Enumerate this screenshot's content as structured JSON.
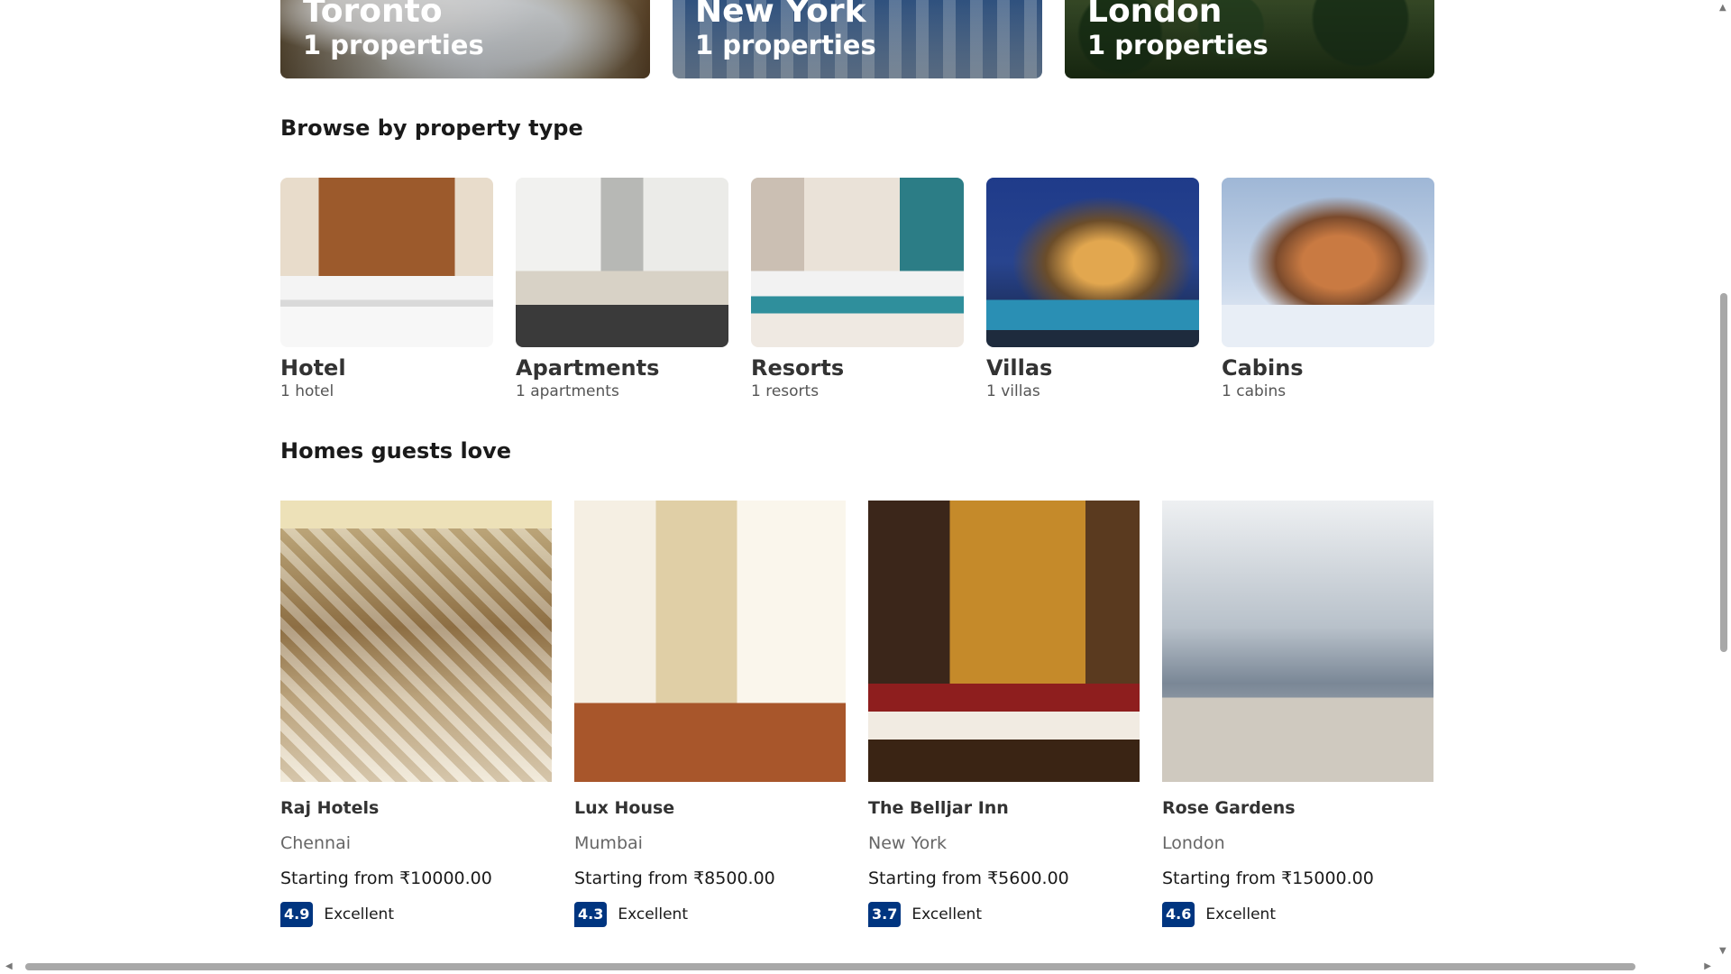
{
  "featured_cities": [
    {
      "name": "Toronto",
      "count": "1 properties"
    },
    {
      "name": "New York",
      "count": "1 properties"
    },
    {
      "name": "London",
      "count": "1 properties"
    }
  ],
  "property_types": {
    "heading": "Browse by property type",
    "items": [
      {
        "title": "Hotel",
        "count": "1 hotel"
      },
      {
        "title": "Apartments",
        "count": "1 apartments"
      },
      {
        "title": "Resorts",
        "count": "1 resorts"
      },
      {
        "title": "Villas",
        "count": "1 villas"
      },
      {
        "title": "Cabins",
        "count": "1 cabins"
      }
    ]
  },
  "homes": {
    "heading": "Homes guests love",
    "items": [
      {
        "name": "Raj Hotels",
        "city": "Chennai",
        "price": "Starting from ₹10000.00",
        "score": "4.9",
        "rating": "Excellent"
      },
      {
        "name": "Lux House",
        "city": "Mumbai",
        "price": "Starting from ₹8500.00",
        "score": "4.3",
        "rating": "Excellent"
      },
      {
        "name": "The Belljar Inn",
        "city": "New York",
        "price": "Starting from ₹5600.00",
        "score": "3.7",
        "rating": "Excellent"
      },
      {
        "name": "Rose Gardens",
        "city": "London",
        "price": "Starting from ₹15000.00",
        "score": "4.6",
        "rating": "Excellent"
      }
    ]
  },
  "colors": {
    "score_badge": "#003580",
    "scrollbar_thumb": "#a8a8a8"
  }
}
